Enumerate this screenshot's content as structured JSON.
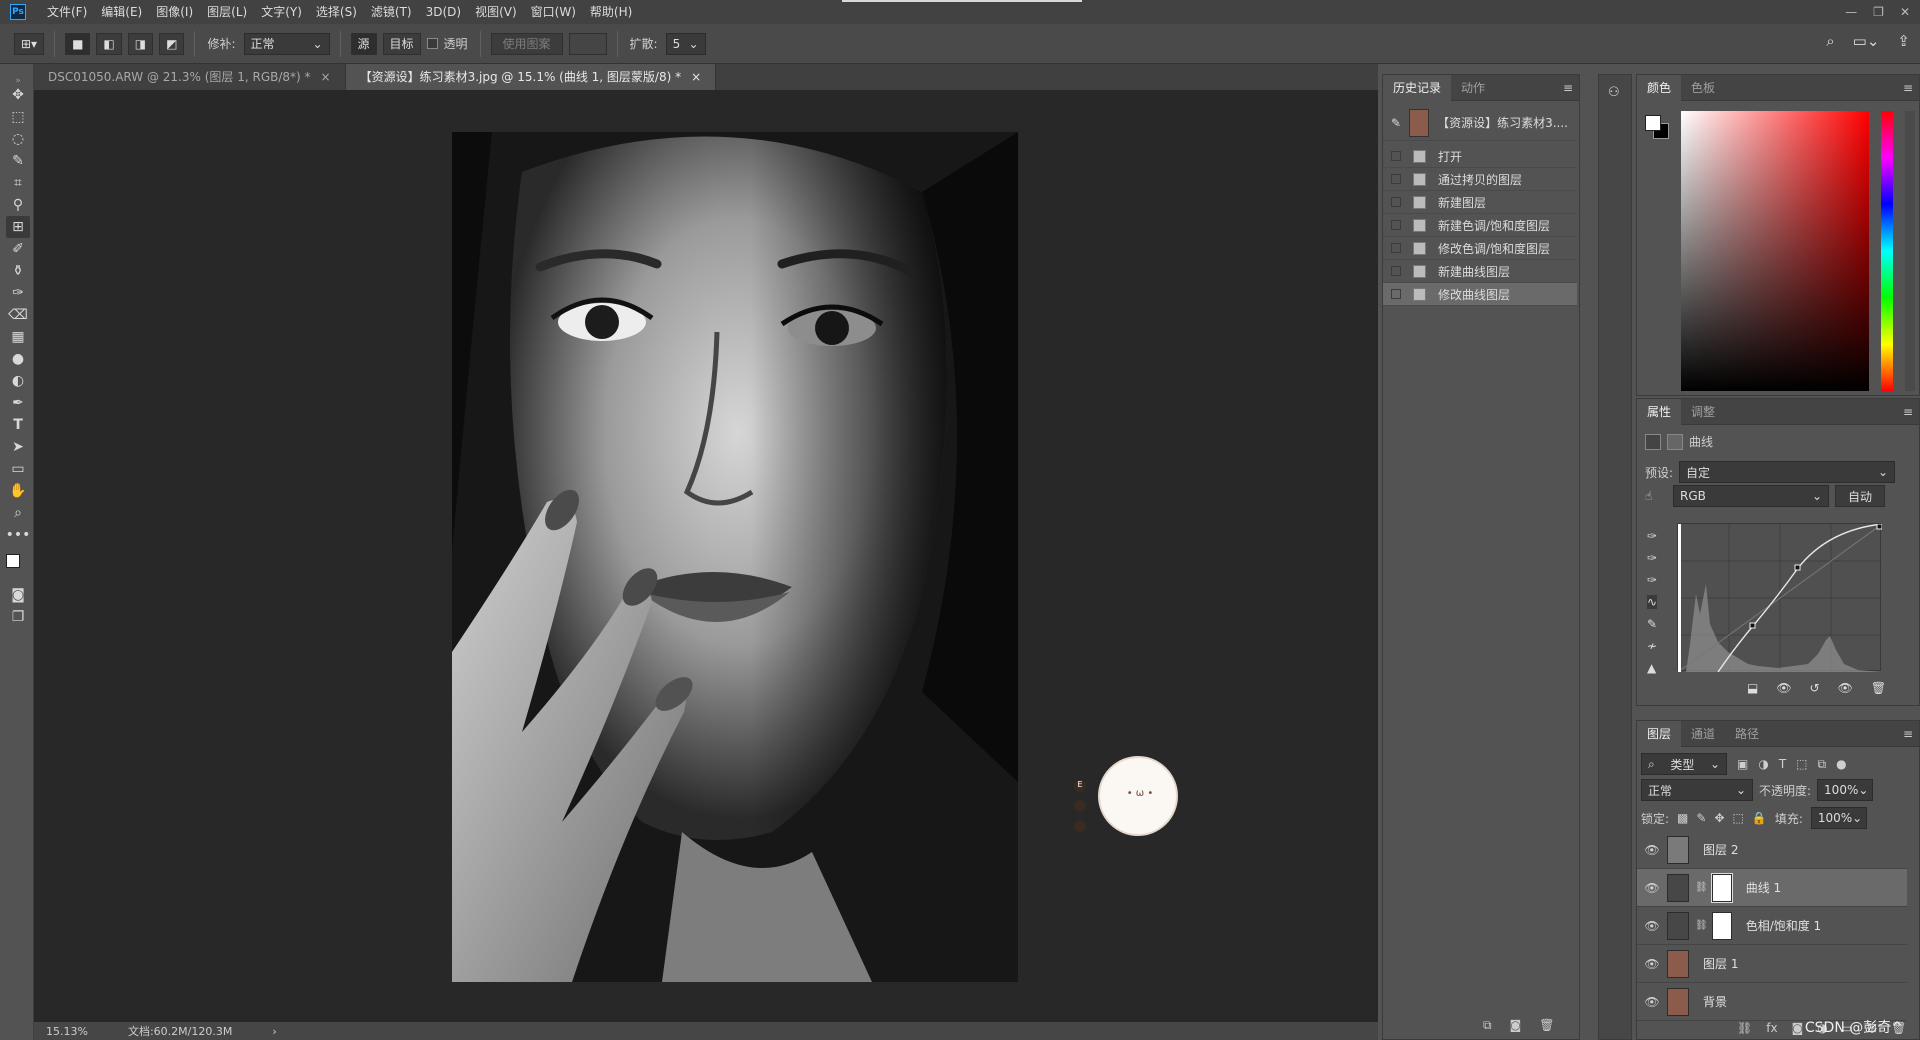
{
  "menu": {
    "logo": "Ps",
    "items": [
      "文件(F)",
      "编辑(E)",
      "图像(I)",
      "图层(L)",
      "文字(Y)",
      "选择(S)",
      "滤镜(T)",
      "3D(D)",
      "视图(V)",
      "窗口(W)",
      "帮助(H)"
    ]
  },
  "window_controls": {
    "minimize": "—",
    "restore": "❐",
    "close": "✕"
  },
  "options": {
    "patch_label": "修补:",
    "patch_value": "正常",
    "source_label": "源",
    "target_label": "目标",
    "transparent_label": "透明",
    "use_pattern_label": "使用图案",
    "diffuse_label": "扩散:",
    "diffuse_value": "5"
  },
  "tabs": [
    {
      "label": "DSC01050.ARW @ 21.3% (图层 1, RGB/8*) *",
      "close": "×"
    },
    {
      "label": "【资源设】练习素材3.jpg @ 15.1% (曲线 1, 图层蒙版/8) *",
      "close": "×"
    }
  ],
  "status": {
    "zoom": "15.13%",
    "doc": "文档:60.2M/120.3M",
    "arrow": "›"
  },
  "history": {
    "tabs": [
      "历史记录",
      "动作"
    ],
    "snapshot": "【资源设】练习素材3....",
    "items": [
      "打开",
      "通过拷贝的图层",
      "新建图层",
      "新建色调/饱和度图层",
      "修改色调/饱和度图层",
      "新建曲线图层",
      "修改曲线图层"
    ]
  },
  "color": {
    "tabs": [
      "颜色",
      "色板"
    ],
    "accent": "#ff0000"
  },
  "properties": {
    "tabs": [
      "属性",
      "调整"
    ],
    "title": "曲线",
    "preset_label": "预设:",
    "preset_value": "自定",
    "channel_value": "RGB",
    "auto_label": "自动"
  },
  "layers": {
    "tabs": [
      "图层",
      "通道",
      "路径"
    ],
    "filter_kind": "类型",
    "blend_mode": "正常",
    "opacity_label": "不透明度:",
    "opacity_value": "100%",
    "lock_label": "锁定:",
    "fill_label": "填充:",
    "fill_value": "100%",
    "rows": [
      {
        "name": "图层 2"
      },
      {
        "name": "曲线 1"
      },
      {
        "name": "色相/饱和度 1"
      },
      {
        "name": "图层 1"
      },
      {
        "name": "背景"
      }
    ],
    "fx": "fx"
  },
  "watermark": "CSDN @彭奇^"
}
